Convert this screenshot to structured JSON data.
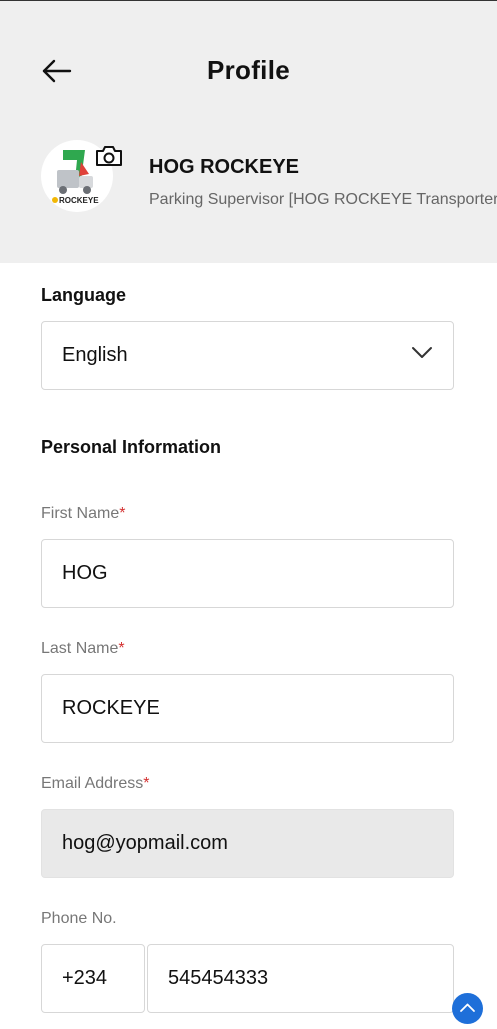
{
  "header": {
    "title": "Profile",
    "back_icon": "arrow-left-icon",
    "profile": {
      "name": "HOG ROCKEYE",
      "role": "Parking Supervisor [HOG ROCKEYE Transporter]",
      "avatar_logo_text": "ROCKEYE",
      "camera_icon": "camera-icon"
    }
  },
  "language": {
    "label": "Language",
    "selected": "English",
    "icon": "chevron-down-icon"
  },
  "personal_info": {
    "heading": "Personal Information",
    "first_name": {
      "label": "First Name",
      "required_mark": "*",
      "value": "HOG"
    },
    "last_name": {
      "label": "Last Name",
      "required_mark": "*",
      "value": "ROCKEYE"
    },
    "email": {
      "label": "Email Address",
      "required_mark": "*",
      "value": "hog@yopmail.com"
    },
    "phone": {
      "label": "Phone No.",
      "code": "+234",
      "number": "545454333"
    }
  },
  "scroll_top_icon": "chevron-up-icon",
  "colors": {
    "header_bg": "#efefef",
    "required": "#d32f2f",
    "accent": "#1e6fd9",
    "disabled_bg": "#e9e9e9"
  }
}
